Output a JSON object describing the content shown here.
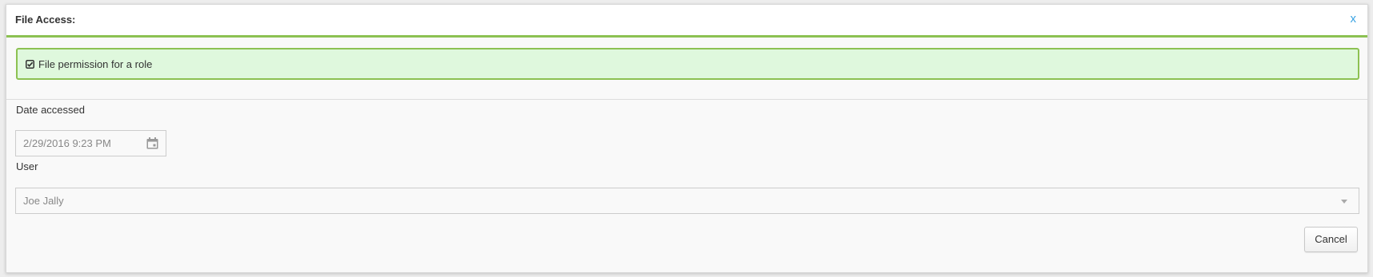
{
  "dialog": {
    "title": "File Access:",
    "close_label": "x"
  },
  "banner": {
    "icon": "check-square-icon",
    "text": "File permission for a role",
    "background": "#dff8dd",
    "border_color": "#8cc152"
  },
  "form": {
    "date_accessed": {
      "label": "Date accessed",
      "value": "2/29/2016 9:23 PM",
      "icon": "calendar-icon"
    },
    "user": {
      "label": "User",
      "selected": "Joe Jally",
      "icon": "chevron-down-icon"
    }
  },
  "actions": {
    "cancel_label": "Cancel"
  },
  "colors": {
    "accent": "#8cc152",
    "close": "#3aa3e3"
  }
}
